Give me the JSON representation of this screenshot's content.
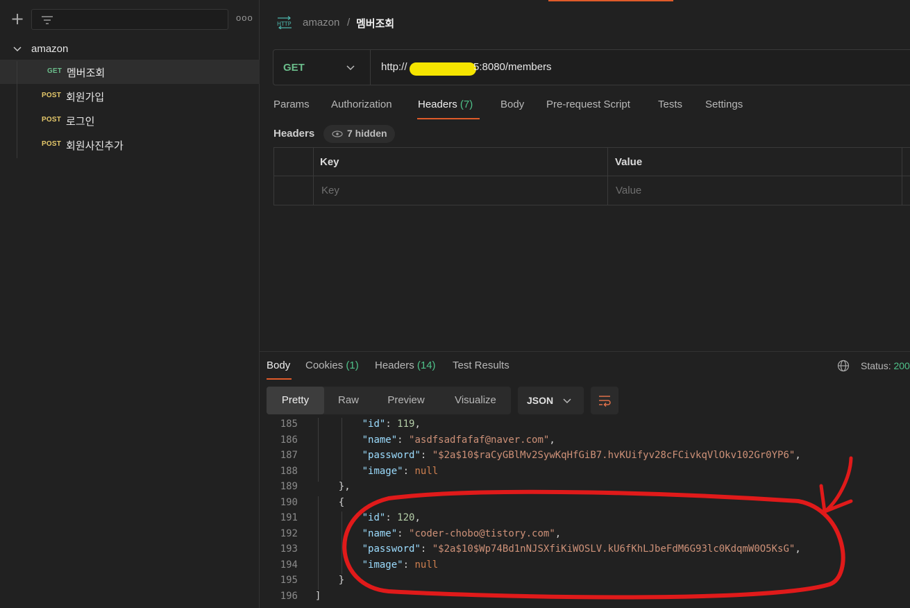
{
  "sidebar": {
    "more_label": "ooo",
    "collection": {
      "name": "amazon"
    },
    "items": [
      {
        "method": "GET",
        "name": "멤버조회"
      },
      {
        "method": "POST",
        "name": "회원가입"
      },
      {
        "method": "POST",
        "name": "로그인"
      },
      {
        "method": "POST",
        "name": "회원사진추가"
      }
    ]
  },
  "header": {
    "icon": "http-icon",
    "breadcrumb_parent": "amazon",
    "breadcrumb_sep": "/",
    "title": "멤버조회"
  },
  "request": {
    "method": "GET",
    "url_prefix": "http://",
    "url_suffix": "5:8080/members",
    "tabs": [
      {
        "label": "Params"
      },
      {
        "label": "Authorization"
      },
      {
        "label": "Headers",
        "count": "(7)"
      },
      {
        "label": "Body"
      },
      {
        "label": "Pre-request Script"
      },
      {
        "label": "Tests"
      },
      {
        "label": "Settings"
      }
    ],
    "headers_label": "Headers",
    "hidden_label": "7 hidden",
    "table": {
      "key_header": "Key",
      "value_header": "Value",
      "key_placeholder": "Key",
      "value_placeholder": "Value"
    }
  },
  "response": {
    "tabs": [
      {
        "label": "Body"
      },
      {
        "label": "Cookies",
        "count": "(1)"
      },
      {
        "label": "Headers",
        "count": "(14)"
      },
      {
        "label": "Test Results"
      }
    ],
    "status_label": "Status:",
    "status_value": "200",
    "views": [
      "Pretty",
      "Raw",
      "Preview",
      "Visualize"
    ],
    "format": "JSON",
    "lines": [
      {
        "n": "185",
        "key": "\"id\"",
        "sep": ": ",
        "val": "119",
        "vtype": "num",
        "end": ","
      },
      {
        "n": "186",
        "key": "\"name\"",
        "sep": ": ",
        "val": "\"asdfsadfafaf@naver.com\"",
        "vtype": "str",
        "end": ","
      },
      {
        "n": "187",
        "key": "\"password\"",
        "sep": ": ",
        "val": "\"$2a$10$raCyGBlMv2SywKqHfGiB7.hvKUifyv28cFCivkqVlOkv102Gr0YP6\"",
        "vtype": "str",
        "end": ","
      },
      {
        "n": "188",
        "key": "\"image\"",
        "sep": ": ",
        "val": "null",
        "vtype": "kw",
        "end": ""
      },
      {
        "n": "189",
        "text": "},",
        "indent": 1
      },
      {
        "n": "190",
        "text": "{",
        "indent": 1
      },
      {
        "n": "191",
        "key": "\"id\"",
        "sep": ": ",
        "val": "120",
        "vtype": "num",
        "end": ","
      },
      {
        "n": "192",
        "key": "\"name\"",
        "sep": ": ",
        "val": "\"coder-chobo@tistory.com\"",
        "vtype": "str",
        "end": ","
      },
      {
        "n": "193",
        "key": "\"password\"",
        "sep": ": ",
        "val": "\"$2a$10$Wp74Bd1nNJSXfiKiWOSLV.kU6fKhLJbeFdM6G93lc0KdqmW0O5KsG\"",
        "vtype": "str",
        "end": ","
      },
      {
        "n": "194",
        "key": "\"image\"",
        "sep": ": ",
        "val": "null",
        "vtype": "kw",
        "end": ""
      },
      {
        "n": "195",
        "text": "}",
        "indent": 1
      },
      {
        "n": "196",
        "text": "]",
        "indent": 0
      }
    ]
  },
  "colors": {
    "accent": "#e05b2a",
    "get": "#6bbd8b",
    "post": "#e6c96b",
    "annotation": "#e01a1a",
    "redaction": "#f5e400"
  }
}
